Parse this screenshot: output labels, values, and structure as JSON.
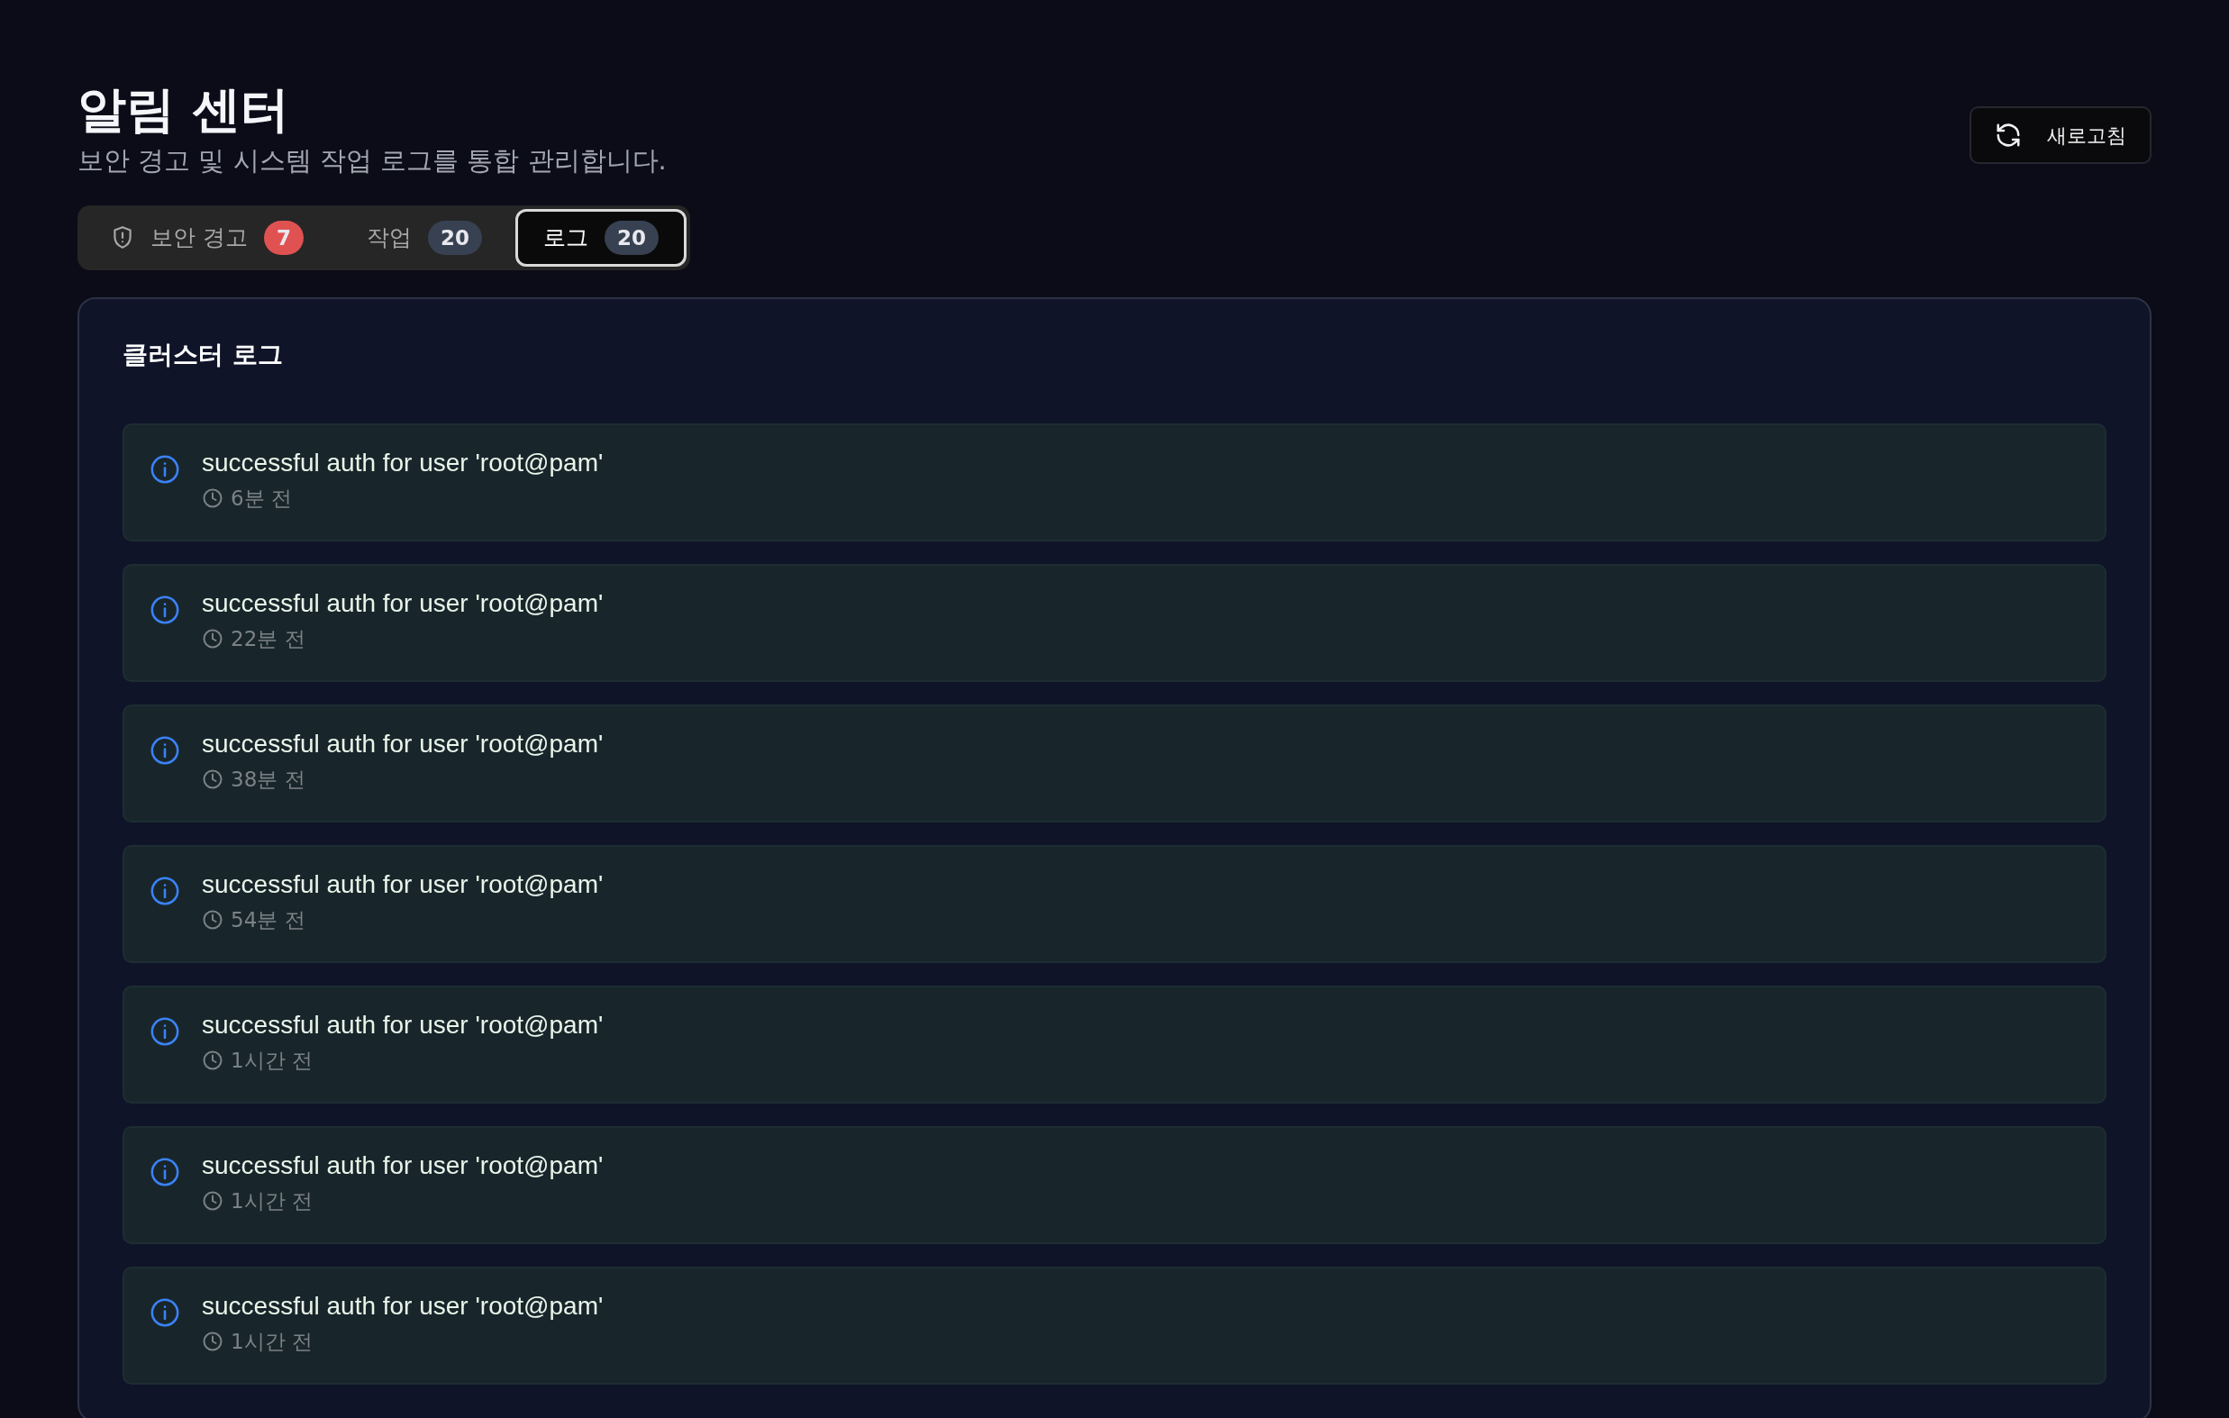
{
  "header": {
    "title": "알림 센터",
    "subtitle": "보안 경고 및 시스템 작업 로그를 통합 관리합니다.",
    "refresh_button": "새로고침"
  },
  "tabs": [
    {
      "label": "보안 경고",
      "kind": "security",
      "count": "7",
      "color": "#e05252",
      "selected": false
    },
    {
      "label": "작업",
      "kind": "plain",
      "count": "20",
      "color": "#374151",
      "selected": false
    },
    {
      "label": "로그",
      "kind": "plain",
      "count": "20",
      "color": "#374151",
      "selected": true
    }
  ],
  "panel": {
    "title": "클러스터 로그",
    "logs": [
      {
        "message": "successful auth for user 'root@pam'",
        "time": "6분 전"
      },
      {
        "message": "successful auth for user 'root@pam'",
        "time": "22분 전"
      },
      {
        "message": "successful auth for user 'root@pam'",
        "time": "38분 전"
      },
      {
        "message": "successful auth for user 'root@pam'",
        "time": "54분 전"
      },
      {
        "message": "successful auth for user 'root@pam'",
        "time": "1시간 전"
      },
      {
        "message": "successful auth for user 'root@pam'",
        "time": "1시간 전"
      },
      {
        "message": "successful auth for user 'root@pam'",
        "time": "1시간 전"
      }
    ]
  }
}
